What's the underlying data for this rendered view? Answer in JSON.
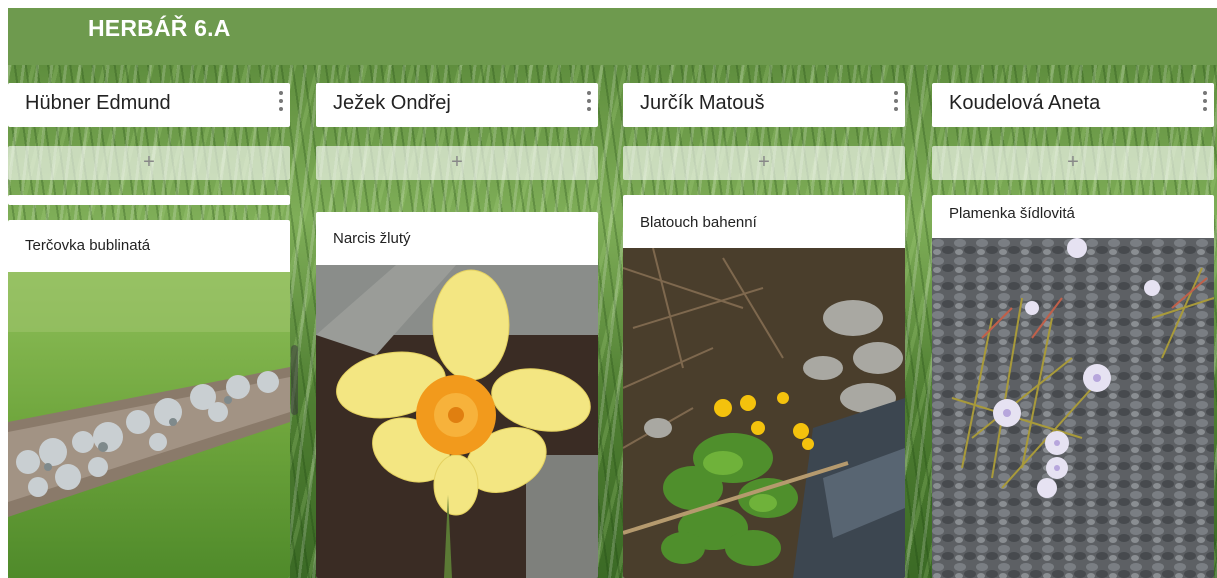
{
  "board": {
    "title": "HERBÁŘ 6.A"
  },
  "add_label": "+",
  "columns": [
    {
      "name": "Hübner Edmund",
      "card": {
        "title": "Terčovka bublinatá",
        "image": "lichen-on-branch"
      }
    },
    {
      "name": "Ježek Ondřej",
      "card": {
        "title": "Narcis žlutý",
        "image": "yellow-daffodil"
      }
    },
    {
      "name": "Jurčík Matouš",
      "card": {
        "title": "Blatouch bahenní",
        "image": "marsh-marigold-by-stream"
      }
    },
    {
      "name": "Koudelová Aneta",
      "card": {
        "title": "Plamenka šídlovitá",
        "image": "phlox-on-gravel"
      }
    }
  ],
  "colors": {
    "header": "#6e9a4e",
    "card": "#ffffff",
    "add_button": "rgba(255,255,255,0.62)"
  }
}
